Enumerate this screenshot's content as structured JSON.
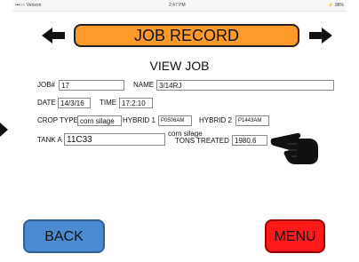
{
  "status_bar": {
    "carrier": "•••○○ Verizon",
    "time": "2:47 PM",
    "battery": "⚡ 98%"
  },
  "header": {
    "title": "JOB RECORD"
  },
  "view_title": "VIEW JOB",
  "fields": {
    "job_label": "JOB#",
    "job_value": "17",
    "name_label": "NAME",
    "name_value": "3/14RJ",
    "date_label": "DATE",
    "date_value": "14/3/16",
    "time_label": "TIME",
    "time_value": "17:2:10",
    "crop_label": "CROP TYPE",
    "crop_value": "corn silage",
    "hybrid1_label": "HYBRID 1",
    "hybrid1_value": "P0506AM",
    "hybrid2_label": "HYBRID 2",
    "hybrid2_value": "P1443AM",
    "tank_label": "TANK A",
    "tank_value": "11C33",
    "tons_label": "TONS TREATED",
    "tons_value": "1980.6",
    "overlay_text": "corn silage"
  },
  "buttons": {
    "back": "BACK",
    "menu": "MENU"
  },
  "icons": {
    "left": "arrow-left-icon",
    "right": "arrow-right-icon",
    "hand": "pointing-hand-icon"
  },
  "colors": {
    "header_pill": "#ff9a2a",
    "back_button": "#4b8bd1",
    "menu_button": "#ff1a1a"
  }
}
